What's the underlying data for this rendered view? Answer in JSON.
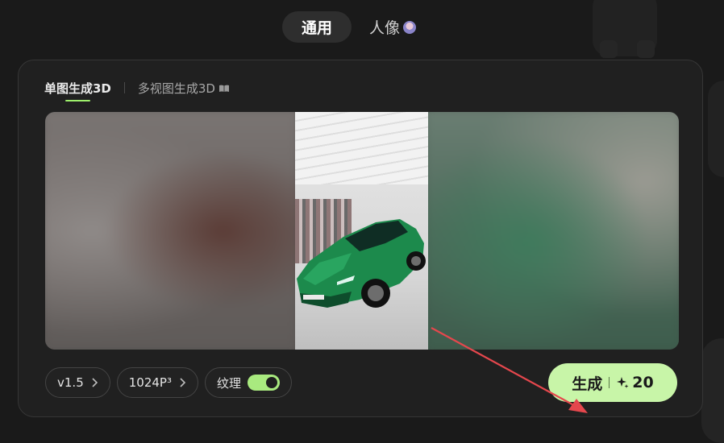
{
  "mode_tabs": {
    "general": "通用",
    "portrait": "人像"
  },
  "sub_tabs": {
    "single": "单图生成3D",
    "multi": "多视图生成3D"
  },
  "controls": {
    "version": "v1.5",
    "resolution": "1024P³",
    "texture_label": "纹理",
    "texture_enabled": true
  },
  "generate": {
    "label": "生成",
    "cost": "20"
  },
  "colors": {
    "accent_green": "#9ef06c",
    "generate_bg": "#c8f5a8",
    "toggle_bg": "#a9ea7f",
    "arrow": "#e5474d",
    "car_body": "#1c8a4c"
  },
  "icons": {
    "portrait_badge": "portrait-avatar-icon",
    "multi_view_help": "book-icon",
    "version_chevron": "chevron-right-icon",
    "resolution_chevron": "chevron-right-icon",
    "credit": "sparkle-icon"
  }
}
